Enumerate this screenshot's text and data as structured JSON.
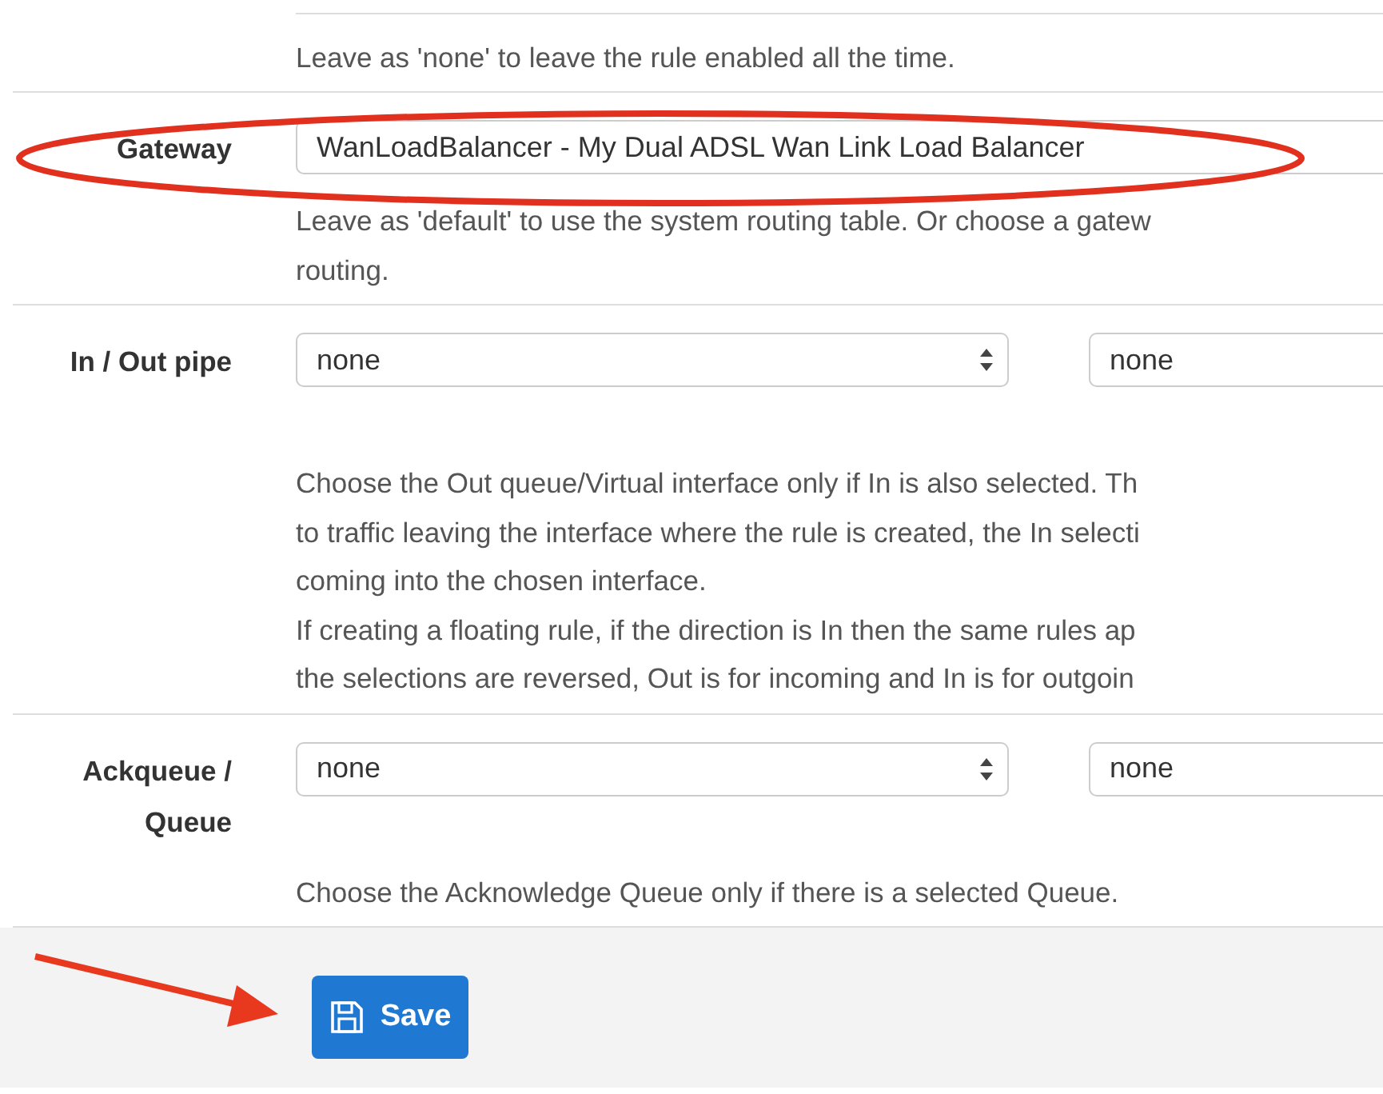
{
  "previous_field": {
    "help": [
      "Leave as 'none' to leave the rule enabled all the time."
    ]
  },
  "fields": [
    {
      "label": [
        "Gateway"
      ],
      "highlighted": true,
      "selects": [
        {
          "value": "WanLoadBalancer - My Dual ADSL Wan Link Load Balancer"
        }
      ],
      "help": [
        "Leave as 'default' to use the system routing table. Or choose a gatew",
        "routing."
      ]
    },
    {
      "label": [
        "In / Out pipe"
      ],
      "highlighted": false,
      "selects": [
        {
          "value": "none"
        },
        {
          "value": "none"
        }
      ],
      "help": [
        "Choose the Out queue/Virtual interface only if In is also selected. Th",
        "to traffic leaving the interface where the rule is created, the In selecti",
        "coming into the chosen interface.",
        "If creating a floating rule, if the direction is In then the same rules ap",
        "the selections are reversed, Out is for incoming and In is for outgoin"
      ]
    },
    {
      "label": [
        "Ackqueue /",
        "Queue"
      ],
      "highlighted": false,
      "selects": [
        {
          "value": "none"
        },
        {
          "value": "none"
        }
      ],
      "help": [
        "Choose the Acknowledge Queue only if there is a selected Queue."
      ]
    }
  ],
  "save_button": {
    "label": "Save",
    "pointed_at": true
  }
}
